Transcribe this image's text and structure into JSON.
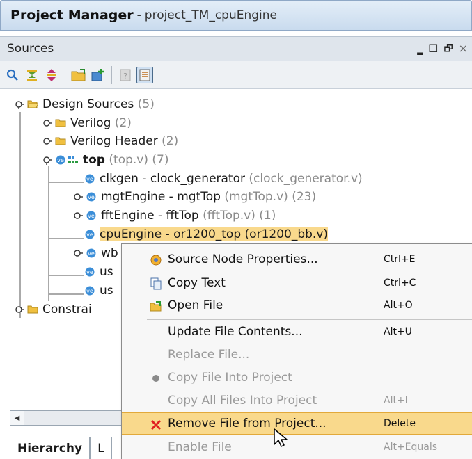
{
  "titlebar": {
    "title": "Project Manager",
    "separator": "-",
    "project": "project_TM_cpuEngine"
  },
  "panel": {
    "title": "Sources",
    "controls": {
      "minimize": "‗",
      "maximize": "☐",
      "restore": "🗗",
      "close": "×"
    }
  },
  "tree": {
    "design_sources": {
      "label": "Design Sources",
      "count": "(5)"
    },
    "verilog": {
      "label": "Verilog",
      "count": "(2)"
    },
    "verilog_header": {
      "label": "Verilog Header",
      "count": "(2)"
    },
    "top": {
      "label": "top",
      "file": "(top.v)",
      "count": "(7)"
    },
    "clkgen": {
      "label": "clkgen - clock_generator",
      "file": "(clock_generator.v)"
    },
    "mgtengine": {
      "label": "mgtEngine - mgtTop",
      "file": "(mgtTop.v)",
      "count": "(23)"
    },
    "fftengine": {
      "label": "fftEngine - fftTop",
      "file": "(fftTop.v)",
      "count": "(1)"
    },
    "cpuengine": {
      "label": "cpuEngine - or1200_top",
      "file": "(or1200_bb.v)"
    },
    "wb": {
      "label": "wb"
    },
    "us1": {
      "label": "us"
    },
    "us2": {
      "label": "us"
    },
    "constraints": {
      "label": "Constrai"
    }
  },
  "tabs": {
    "hierarchy": "Hierarchy",
    "second": "L"
  },
  "context_menu": {
    "source_node_properties": {
      "label": "Source Node Properties...",
      "shortcut": "Ctrl+E"
    },
    "copy_text": {
      "label": "Copy Text",
      "shortcut": "Ctrl+C"
    },
    "open_file": {
      "label": "Open File",
      "shortcut": "Alt+O"
    },
    "update_file_contents": {
      "label": "Update File Contents...",
      "shortcut": "Alt+U"
    },
    "replace_file": {
      "label": "Replace File..."
    },
    "copy_file_into_project": {
      "label": "Copy File Into Project"
    },
    "copy_all_files": {
      "label": "Copy All Files Into Project",
      "shortcut": "Alt+I"
    },
    "remove_file": {
      "label": "Remove File from Project...",
      "shortcut": "Delete"
    },
    "enable_file": {
      "label": "Enable File",
      "shortcut": "Alt+Equals"
    }
  },
  "colors": {
    "highlight": "#f9d98c",
    "remove_x": "#e02020",
    "folder": "#f0c040",
    "verilog_icon": "#3b8ed8"
  }
}
